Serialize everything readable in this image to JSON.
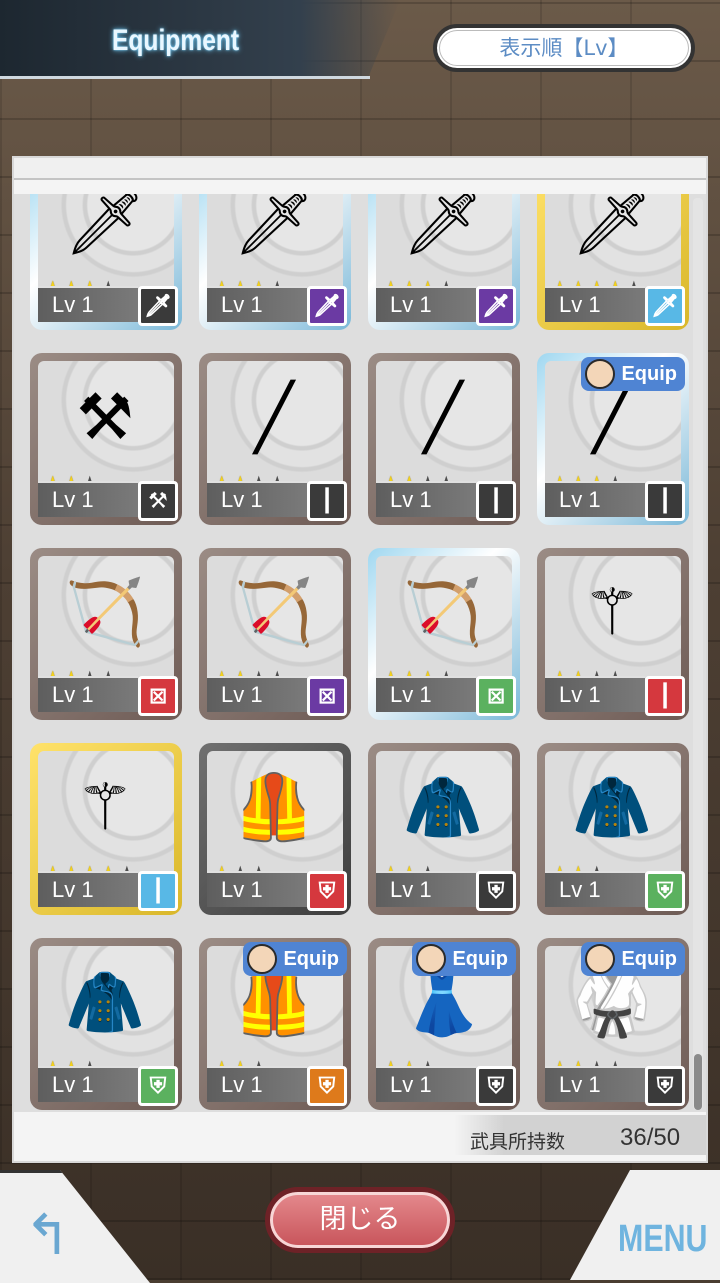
{
  "header": {
    "title": "Equipment",
    "sort_button": "表示順【Lv】"
  },
  "grid": {
    "cards": [
      {
        "frame": "silver",
        "art": "spear",
        "stars": 3,
        "max_stars": 4,
        "lv": "Lv 1",
        "type": "gray",
        "type_icon": "sword-icon",
        "equip": null
      },
      {
        "frame": "silver",
        "art": "spear",
        "stars": 3,
        "max_stars": 4,
        "lv": "Lv 1",
        "type": "purple",
        "type_icon": "sword-icon",
        "equip": null
      },
      {
        "frame": "silver",
        "art": "spear",
        "stars": 3,
        "max_stars": 4,
        "lv": "Lv 1",
        "type": "purple",
        "type_icon": "sword-icon",
        "equip": null
      },
      {
        "frame": "gold",
        "art": "spear",
        "stars": 4,
        "max_stars": 5,
        "lv": "Lv 1",
        "type": "cyan",
        "type_icon": "sword-icon",
        "equip": null
      },
      {
        "frame": "bronze",
        "art": "mace",
        "stars": 2,
        "max_stars": 3,
        "lv": "Lv 1",
        "type": "gray",
        "type_icon": "mace-icon",
        "equip": null
      },
      {
        "frame": "bronze",
        "art": "rifle",
        "stars": 2,
        "max_stars": 4,
        "lv": "Lv 1",
        "type": "gray",
        "type_icon": "bullet-icon",
        "equip": null
      },
      {
        "frame": "bronze",
        "art": "rifle",
        "stars": 2,
        "max_stars": 4,
        "lv": "Lv 1",
        "type": "gray",
        "type_icon": "bullet-icon",
        "equip": null
      },
      {
        "frame": "silver",
        "art": "rifle",
        "stars": 3,
        "max_stars": 4,
        "lv": "Lv 1",
        "type": "gray",
        "type_icon": "bullet-icon",
        "equip": "Equip"
      },
      {
        "frame": "bronze",
        "art": "bow",
        "stars": 2,
        "max_stars": 4,
        "lv": "Lv 1",
        "type": "red",
        "type_icon": "bow-icon",
        "equip": null
      },
      {
        "frame": "bronze",
        "art": "bow",
        "stars": 2,
        "max_stars": 4,
        "lv": "Lv 1",
        "type": "purple",
        "type_icon": "bow-icon",
        "equip": null
      },
      {
        "frame": "silver",
        "art": "bow",
        "stars": 3,
        "max_stars": 4,
        "lv": "Lv 1",
        "type": "green",
        "type_icon": "bow-icon",
        "equip": null
      },
      {
        "frame": "bronze",
        "art": "staff",
        "stars": 2,
        "max_stars": 4,
        "lv": "Lv 1",
        "type": "red",
        "type_icon": "staff-icon",
        "equip": null
      },
      {
        "frame": "gold",
        "art": "staff",
        "stars": 4,
        "max_stars": 5,
        "lv": "Lv 1",
        "type": "cyan",
        "type_icon": "staff-icon",
        "equip": null
      },
      {
        "frame": "gray",
        "art": "armor",
        "stars": 1,
        "max_stars": 3,
        "lv": "Lv 1",
        "type": "red",
        "type_icon": "armor-icon",
        "equip": null
      },
      {
        "frame": "bronze",
        "art": "cloak",
        "stars": 2,
        "max_stars": 3,
        "lv": "Lv 1",
        "type": "gray",
        "type_icon": "armor-icon",
        "equip": null
      },
      {
        "frame": "bronze",
        "art": "coat",
        "stars": 2,
        "max_stars": 3,
        "lv": "Lv 1",
        "type": "green",
        "type_icon": "armor-icon",
        "equip": null
      },
      {
        "frame": "bronze",
        "art": "coat",
        "stars": 2,
        "max_stars": 3,
        "lv": "Lv 1",
        "type": "green",
        "type_icon": "armor-icon",
        "equip": null
      },
      {
        "frame": "bronze",
        "art": "armor",
        "stars": 2,
        "max_stars": 3,
        "lv": "Lv 1",
        "type": "orange",
        "type_icon": "armor-icon",
        "equip": "Equip"
      },
      {
        "frame": "bronze",
        "art": "dress",
        "stars": 2,
        "max_stars": 3,
        "lv": "Lv 1",
        "type": "gray",
        "type_icon": "armor-icon",
        "equip": "Equip"
      },
      {
        "frame": "bronze",
        "art": "uniform",
        "stars": 2,
        "max_stars": 4,
        "lv": "Lv 1",
        "type": "gray",
        "type_icon": "armor-icon",
        "equip": "Equip"
      }
    ]
  },
  "footer": {
    "count_label": "武具所持数",
    "count_value": "36/50"
  },
  "bottom": {
    "close_button": "閉じる",
    "menu_label": "MENU"
  }
}
